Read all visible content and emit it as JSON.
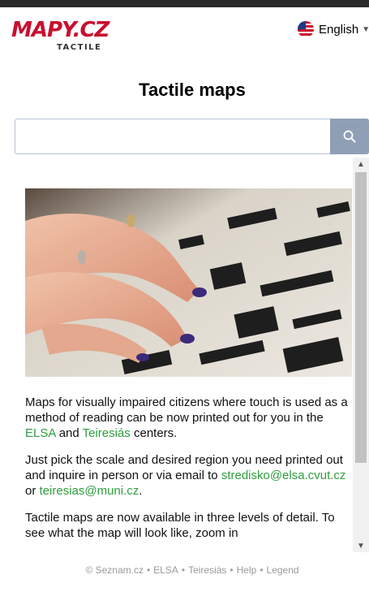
{
  "header": {
    "logo_main": "MAPY.CZ",
    "logo_sub": "TACTILE",
    "language": {
      "label": "English",
      "icon": "us-flag-icon"
    }
  },
  "page": {
    "title": "Tactile maps"
  },
  "search": {
    "value": "",
    "placeholder": "",
    "icon": "search-icon"
  },
  "content": {
    "image": "hands-reading-tactile-map",
    "para1_text": "Maps for visually impaired citizens where touch is used as a method of reading can be now printed out for you in the ",
    "para1_link1": "ELSA",
    "para1_mid": " and ",
    "para1_link2": "Teiresiás",
    "para1_end": " centers.",
    "para2_text": "Just pick the scale and desired region you need printed out and inquire in person or via email to ",
    "para2_link1": "stredisko@elsa.cvut.cz",
    "para2_mid": " or ",
    "para2_link2": "teiresias@muni.cz",
    "para2_end": ".",
    "para3_text": "Tactile maps are now available in three levels of detail. To see what the map will look like, zoom in"
  },
  "footer": {
    "copyright": "© Seznam.cz",
    "sep": "•",
    "links": [
      "ELSA",
      "Teiresiás",
      "Help",
      "Legend"
    ]
  },
  "colors": {
    "brand_red": "#c8102e",
    "link_green": "#2e9e3c",
    "search_button": "#8fa0b6"
  }
}
